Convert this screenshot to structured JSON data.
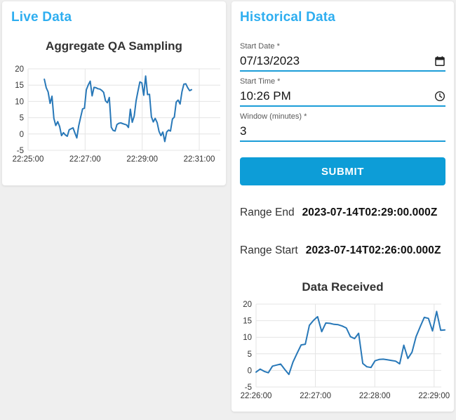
{
  "colors": {
    "accent_heading": "#2EAEF0",
    "submit_button": "#0D9DD7",
    "field_underline": "#1C9DD8",
    "line": "#2878B8",
    "grid": "#E4E4E4",
    "tick_text": "#333333",
    "page_background": "#EFEFEF",
    "card_background": "#FFFFFF"
  },
  "left_panel": {
    "title": "Live Data"
  },
  "right_panel": {
    "title": "Historical Data",
    "fields": [
      {
        "label": "Start Date *",
        "value": "07/13/2023",
        "icon": "calendar"
      },
      {
        "label": "Start Time *",
        "value": "10:26 PM",
        "icon": "clock"
      },
      {
        "label": "Window (minutes) *",
        "value": "3",
        "icon": "none"
      }
    ],
    "submit_label": "SUBMIT",
    "range_end": {
      "label": "Range End",
      "value": "2023-07-14T02:29:00.000Z"
    },
    "range_start": {
      "label": "Range Start",
      "value": "2023-07-14T02:26:00.000Z"
    }
  },
  "chart_data": [
    {
      "type": "line",
      "title": "Aggregate QA Sampling",
      "xlabel": "",
      "ylabel": "",
      "x_ticks": [
        "22:25:00",
        "22:27:00",
        "22:29:00",
        "22:31:00"
      ],
      "y_ticks": [
        20,
        15,
        10,
        5,
        0,
        -5
      ],
      "ylim": [
        -5,
        20
      ],
      "grid": true,
      "legend": "none",
      "line_color": "#2878B8",
      "x_axis_overshoot_frac": 0.123,
      "x_data_span_frac": [
        0.095,
        0.955
      ],
      "values": [
        16.8,
        14.2,
        12.9,
        9.4,
        11.6,
        4.8,
        2.6,
        3.8,
        2.3,
        -0.5,
        0.4,
        -0.3,
        -0.7,
        1.3,
        1.6,
        1.9,
        0.3,
        -1.2,
        2.5,
        5.2,
        7.7,
        7.9,
        13.6,
        15.1,
        16.2,
        11.7,
        14.3,
        14.2,
        13.9,
        13.8,
        13.4,
        12.8,
        10.2,
        9.6,
        11.2,
        2.1,
        1.1,
        0.9,
        2.9,
        3.3,
        3.4,
        3.2,
        3.0,
        2.8,
        2.0,
        7.6,
        3.6,
        5.5,
        10.2,
        13.2,
        16.0,
        15.7,
        11.9,
        17.8,
        12.1,
        12.2,
        5.3,
        3.7,
        4.8,
        3.5,
        0.8,
        -0.5,
        0.6,
        -2.3,
        0.6,
        1.2,
        0.9,
        4.6,
        5.2,
        9.8,
        10.4,
        9.2,
        13.0,
        15.3,
        15.4,
        14.2,
        13.3,
        13.6
      ]
    },
    {
      "type": "line",
      "title": "Data Received",
      "xlabel": "",
      "ylabel": "",
      "x_ticks": [
        "22:26:00",
        "22:27:00",
        "22:28:00",
        "22:29:00"
      ],
      "y_ticks": [
        20,
        15,
        10,
        5,
        0,
        -5
      ],
      "ylim": [
        -5,
        20
      ],
      "grid": true,
      "legend": "none",
      "line_color": "#2878B8",
      "x_axis_overshoot_frac": 0.04,
      "x_data_span_frac": [
        0.0,
        1.06
      ],
      "values": [
        -0.5,
        0.4,
        -0.3,
        -0.7,
        1.3,
        1.6,
        1.9,
        0.3,
        -1.2,
        2.5,
        5.2,
        7.7,
        7.9,
        13.6,
        15.1,
        16.2,
        11.7,
        14.3,
        14.2,
        13.9,
        13.8,
        13.4,
        12.8,
        10.2,
        9.6,
        11.2,
        2.1,
        1.1,
        0.9,
        2.9,
        3.3,
        3.4,
        3.2,
        3.0,
        2.8,
        2.0,
        7.6,
        3.6,
        5.5,
        10.2,
        13.2,
        16.0,
        15.7,
        11.9,
        17.8,
        12.1,
        12.2
      ]
    }
  ]
}
